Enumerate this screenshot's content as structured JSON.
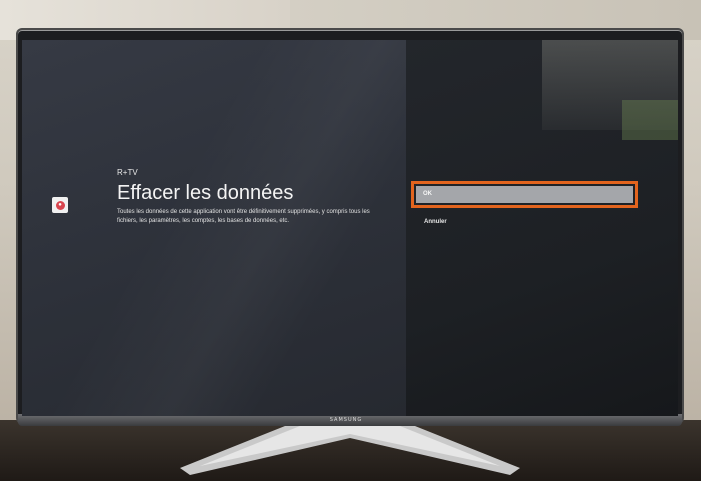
{
  "dialog": {
    "app_name": "R+TV",
    "title": "Effacer les données",
    "description": "Toutes les données de cette application vont être définitivement supprimées, y compris tous les fichiers, les paramètres, les comptes, les bases de données, etc."
  },
  "actions": [
    {
      "label": "OK",
      "selected": true
    },
    {
      "label": "Annuler",
      "selected": false
    }
  ],
  "device": {
    "brand": "SAMSUNG"
  },
  "colors": {
    "highlight": "#e2641e",
    "selected_bg": "#a4a6aa"
  },
  "icons": {
    "app_icon": "app-icon"
  }
}
